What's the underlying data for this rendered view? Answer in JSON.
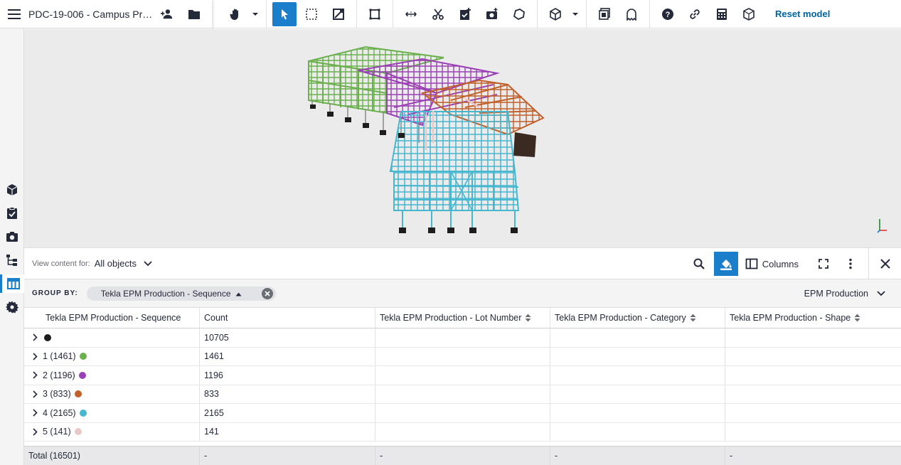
{
  "topbar": {
    "project_title": "PDC-19-006 - Campus Proj...",
    "reset_label": "Reset model",
    "accent_color": "#1a7ecb"
  },
  "sidebar": {
    "icons": [
      "cube-icon",
      "checklist-icon",
      "camera-icon",
      "tree-icon",
      "table-icon",
      "gear-icon"
    ],
    "active": "table-icon"
  },
  "panel": {
    "view_for_label": "View content for:",
    "view_for_value": "All objects",
    "columns_label": "Columns"
  },
  "groupby": {
    "label": "GROUP BY:",
    "chip_label": "Tekla EPM Production - Sequence",
    "dropdown_label": "EPM Production"
  },
  "table": {
    "headers": [
      "Tekla EPM Production - Sequence",
      "Count",
      "Tekla EPM Production - Lot Number",
      "Tekla EPM Production - Category",
      "Tekla EPM Production - Shape"
    ],
    "rows": [
      {
        "label": "",
        "color": "#1d1d1d",
        "count": "10705"
      },
      {
        "label": "1 (1461)",
        "color": "#6ab04c",
        "count": "1461"
      },
      {
        "label": "2 (1196)",
        "color": "#9b3fb5",
        "count": "1196"
      },
      {
        "label": "3 (833)",
        "color": "#c0602a",
        "count": "833"
      },
      {
        "label": "4 (2165)",
        "color": "#45b8cf",
        "count": "2165"
      },
      {
        "label": "5 (141)",
        "color": "#e8c9c9",
        "count": "141"
      }
    ],
    "total": {
      "label": "Total (16501)",
      "count": "-",
      "lot": "-",
      "category": "-",
      "shape": "-"
    }
  }
}
